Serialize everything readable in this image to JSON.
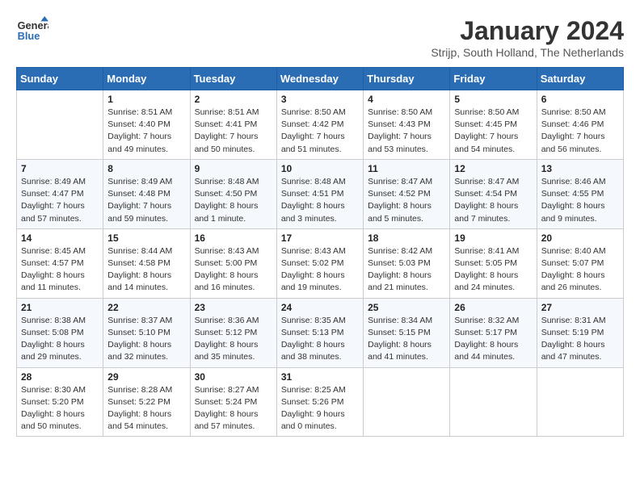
{
  "header": {
    "logo_line1": "General",
    "logo_line2": "Blue",
    "month_title": "January 2024",
    "subtitle": "Strijp, South Holland, The Netherlands"
  },
  "weekdays": [
    "Sunday",
    "Monday",
    "Tuesday",
    "Wednesday",
    "Thursday",
    "Friday",
    "Saturday"
  ],
  "weeks": [
    [
      {
        "day": "",
        "info": ""
      },
      {
        "day": "1",
        "info": "Sunrise: 8:51 AM\nSunset: 4:40 PM\nDaylight: 7 hours\nand 49 minutes."
      },
      {
        "day": "2",
        "info": "Sunrise: 8:51 AM\nSunset: 4:41 PM\nDaylight: 7 hours\nand 50 minutes."
      },
      {
        "day": "3",
        "info": "Sunrise: 8:50 AM\nSunset: 4:42 PM\nDaylight: 7 hours\nand 51 minutes."
      },
      {
        "day": "4",
        "info": "Sunrise: 8:50 AM\nSunset: 4:43 PM\nDaylight: 7 hours\nand 53 minutes."
      },
      {
        "day": "5",
        "info": "Sunrise: 8:50 AM\nSunset: 4:45 PM\nDaylight: 7 hours\nand 54 minutes."
      },
      {
        "day": "6",
        "info": "Sunrise: 8:50 AM\nSunset: 4:46 PM\nDaylight: 7 hours\nand 56 minutes."
      }
    ],
    [
      {
        "day": "7",
        "info": "Sunrise: 8:49 AM\nSunset: 4:47 PM\nDaylight: 7 hours\nand 57 minutes."
      },
      {
        "day": "8",
        "info": "Sunrise: 8:49 AM\nSunset: 4:48 PM\nDaylight: 7 hours\nand 59 minutes."
      },
      {
        "day": "9",
        "info": "Sunrise: 8:48 AM\nSunset: 4:50 PM\nDaylight: 8 hours\nand 1 minute."
      },
      {
        "day": "10",
        "info": "Sunrise: 8:48 AM\nSunset: 4:51 PM\nDaylight: 8 hours\nand 3 minutes."
      },
      {
        "day": "11",
        "info": "Sunrise: 8:47 AM\nSunset: 4:52 PM\nDaylight: 8 hours\nand 5 minutes."
      },
      {
        "day": "12",
        "info": "Sunrise: 8:47 AM\nSunset: 4:54 PM\nDaylight: 8 hours\nand 7 minutes."
      },
      {
        "day": "13",
        "info": "Sunrise: 8:46 AM\nSunset: 4:55 PM\nDaylight: 8 hours\nand 9 minutes."
      }
    ],
    [
      {
        "day": "14",
        "info": "Sunrise: 8:45 AM\nSunset: 4:57 PM\nDaylight: 8 hours\nand 11 minutes."
      },
      {
        "day": "15",
        "info": "Sunrise: 8:44 AM\nSunset: 4:58 PM\nDaylight: 8 hours\nand 14 minutes."
      },
      {
        "day": "16",
        "info": "Sunrise: 8:43 AM\nSunset: 5:00 PM\nDaylight: 8 hours\nand 16 minutes."
      },
      {
        "day": "17",
        "info": "Sunrise: 8:43 AM\nSunset: 5:02 PM\nDaylight: 8 hours\nand 19 minutes."
      },
      {
        "day": "18",
        "info": "Sunrise: 8:42 AM\nSunset: 5:03 PM\nDaylight: 8 hours\nand 21 minutes."
      },
      {
        "day": "19",
        "info": "Sunrise: 8:41 AM\nSunset: 5:05 PM\nDaylight: 8 hours\nand 24 minutes."
      },
      {
        "day": "20",
        "info": "Sunrise: 8:40 AM\nSunset: 5:07 PM\nDaylight: 8 hours\nand 26 minutes."
      }
    ],
    [
      {
        "day": "21",
        "info": "Sunrise: 8:38 AM\nSunset: 5:08 PM\nDaylight: 8 hours\nand 29 minutes."
      },
      {
        "day": "22",
        "info": "Sunrise: 8:37 AM\nSunset: 5:10 PM\nDaylight: 8 hours\nand 32 minutes."
      },
      {
        "day": "23",
        "info": "Sunrise: 8:36 AM\nSunset: 5:12 PM\nDaylight: 8 hours\nand 35 minutes."
      },
      {
        "day": "24",
        "info": "Sunrise: 8:35 AM\nSunset: 5:13 PM\nDaylight: 8 hours\nand 38 minutes."
      },
      {
        "day": "25",
        "info": "Sunrise: 8:34 AM\nSunset: 5:15 PM\nDaylight: 8 hours\nand 41 minutes."
      },
      {
        "day": "26",
        "info": "Sunrise: 8:32 AM\nSunset: 5:17 PM\nDaylight: 8 hours\nand 44 minutes."
      },
      {
        "day": "27",
        "info": "Sunrise: 8:31 AM\nSunset: 5:19 PM\nDaylight: 8 hours\nand 47 minutes."
      }
    ],
    [
      {
        "day": "28",
        "info": "Sunrise: 8:30 AM\nSunset: 5:20 PM\nDaylight: 8 hours\nand 50 minutes."
      },
      {
        "day": "29",
        "info": "Sunrise: 8:28 AM\nSunset: 5:22 PM\nDaylight: 8 hours\nand 54 minutes."
      },
      {
        "day": "30",
        "info": "Sunrise: 8:27 AM\nSunset: 5:24 PM\nDaylight: 8 hours\nand 57 minutes."
      },
      {
        "day": "31",
        "info": "Sunrise: 8:25 AM\nSunset: 5:26 PM\nDaylight: 9 hours\nand 0 minutes."
      },
      {
        "day": "",
        "info": ""
      },
      {
        "day": "",
        "info": ""
      },
      {
        "day": "",
        "info": ""
      }
    ]
  ]
}
